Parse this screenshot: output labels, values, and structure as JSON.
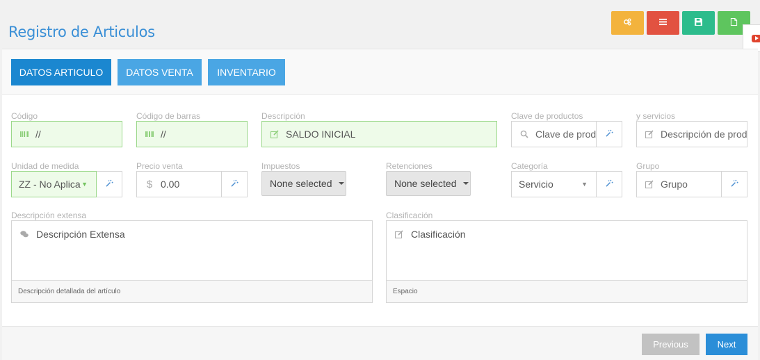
{
  "header": {
    "title": "Registro de Articulos"
  },
  "toolbar": {
    "buttons": [
      {
        "icon": "gears-icon",
        "color": "#f3b33d"
      },
      {
        "icon": "list-icon",
        "color": "#e25241"
      },
      {
        "icon": "save-icon",
        "color": "#2dbc8c"
      },
      {
        "icon": "new-file-icon",
        "color": "#5ec55e"
      }
    ]
  },
  "tabs": [
    {
      "label": "DATOS ARTICULO",
      "active": true
    },
    {
      "label": "DATOS VENTA",
      "active": false
    },
    {
      "label": "INVENTARIO",
      "active": false
    }
  ],
  "form": {
    "codigo": {
      "label": "Código",
      "value": "//"
    },
    "codigo_barras": {
      "label": "Código de barras",
      "value": "//"
    },
    "descripcion": {
      "label": "Descripción",
      "value": "SALDO INICIAL"
    },
    "clave_productos": {
      "label": "Clave de productos",
      "placeholder": "Clave de prod"
    },
    "servicios": {
      "label": "y servicios",
      "placeholder": "Descripción de prod"
    },
    "unidad_medida": {
      "label": "Unidad de medida",
      "value": "ZZ - No Aplica"
    },
    "precio_venta": {
      "label": "Precio venta",
      "value": "0.00"
    },
    "impuestos": {
      "label": "Impuestos",
      "value": "None selected"
    },
    "retenciones": {
      "label": "Retenciones",
      "value": "None selected"
    },
    "categoria": {
      "label": "Categoría",
      "value": "Servicio"
    },
    "grupo": {
      "label": "Grupo",
      "placeholder": "Grupo"
    },
    "descripcion_extensa": {
      "label": "Descripción extensa",
      "placeholder": "Descripción Extensa",
      "help": "Descripción detallada del artículo"
    },
    "clasificacion": {
      "label": "Clasificación",
      "placeholder": "Clasificación",
      "help": "Espacio"
    }
  },
  "footer": {
    "previous_label": "Previous",
    "next_label": "Next"
  },
  "colors": {
    "accent": "#3a8fd6",
    "tab_active": "#1b87d0",
    "tab_inactive": "#4aa6e4",
    "valid_bg": "#eefbe9",
    "valid_border": "#9bd88a"
  }
}
